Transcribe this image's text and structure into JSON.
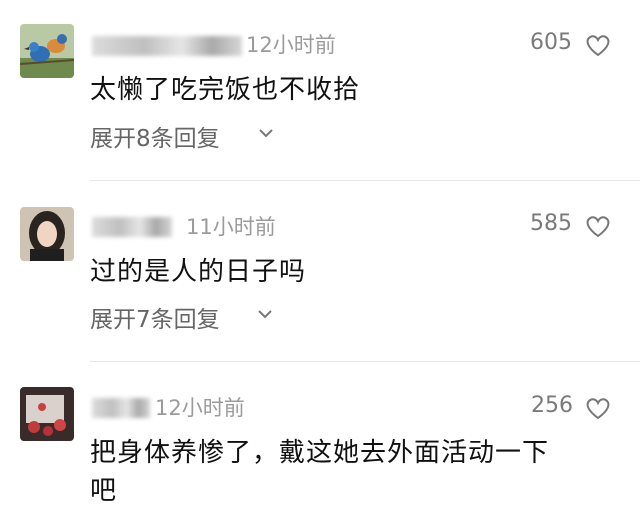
{
  "comments": [
    {
      "time": "12小时前",
      "likes": "605",
      "text": "太懒了吃完饭也不收拾",
      "expand": "展开8条回复",
      "avatar_icon": "bird-avatar-icon"
    },
    {
      "time": "11小时前",
      "likes": "585",
      "text": "过的是人的日子吗",
      "expand": "展开7条回复",
      "avatar_icon": "woman-avatar-icon"
    },
    {
      "time": "12小时前",
      "likes": "256",
      "text": "把身体养惨了，戴这她去外面活动一下",
      "text_line2": "吧",
      "avatar_icon": "flower-avatar-icon"
    }
  ],
  "colors": {
    "text": "#111111",
    "meta": "#9b9b9b",
    "divider": "#e7e7e7"
  }
}
